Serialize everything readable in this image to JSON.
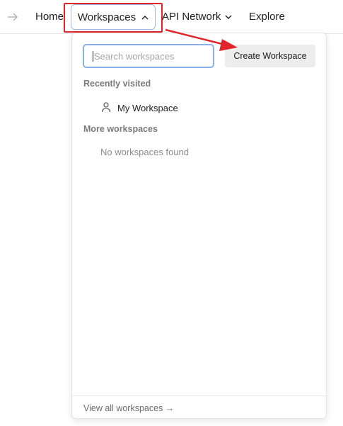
{
  "nav": {
    "forward_icon": "arrow-right-icon",
    "home_label": "Home",
    "workspaces_label": "Workspaces",
    "api_network_label": "API Network",
    "explore_label": "Explore"
  },
  "dropdown": {
    "search_placeholder": "Search workspaces",
    "create_button_label": "Create Workspace",
    "recently_visited_label": "Recently visited",
    "recent_items": [
      {
        "name": "My Workspace",
        "icon": "user-icon"
      }
    ],
    "more_workspaces_label": "More workspaces",
    "empty_message": "No workspaces found",
    "footer_link": "View all workspaces →"
  },
  "colors": {
    "highlight_box": "#e0262a",
    "annotation_arrow": "#e0262a",
    "focus_border": "#8ab0ea",
    "button_bg": "#ededed"
  }
}
